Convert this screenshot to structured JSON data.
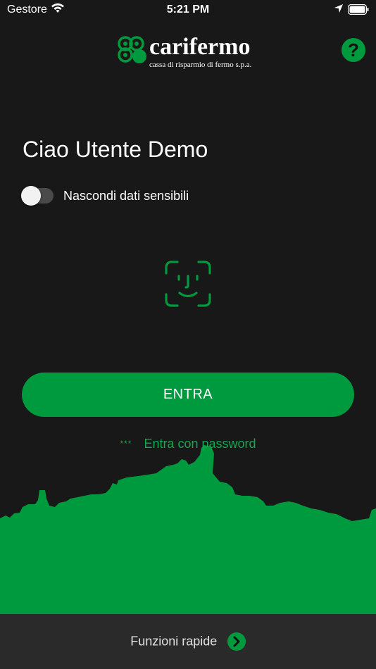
{
  "status_bar": {
    "carrier": "Gestore",
    "time": "5:21 PM"
  },
  "header": {
    "brand": "carifermo",
    "tagline": "cassa di risparmio di fermo s.p.a.",
    "help_label": "?"
  },
  "greeting": "Ciao Utente Demo",
  "sensitive_toggle": {
    "label": "Nascondi dati sensibili",
    "on": false
  },
  "face_id_icon": "face-id-icon",
  "enter_button": "ENTRA",
  "password_link": {
    "stars": "***",
    "label": "Entra con password"
  },
  "footer": {
    "quick_functions_label": "Funzioni rapide"
  },
  "colors": {
    "accent": "#009a3e",
    "background": "#181818",
    "footer": "#2a2a2a"
  }
}
